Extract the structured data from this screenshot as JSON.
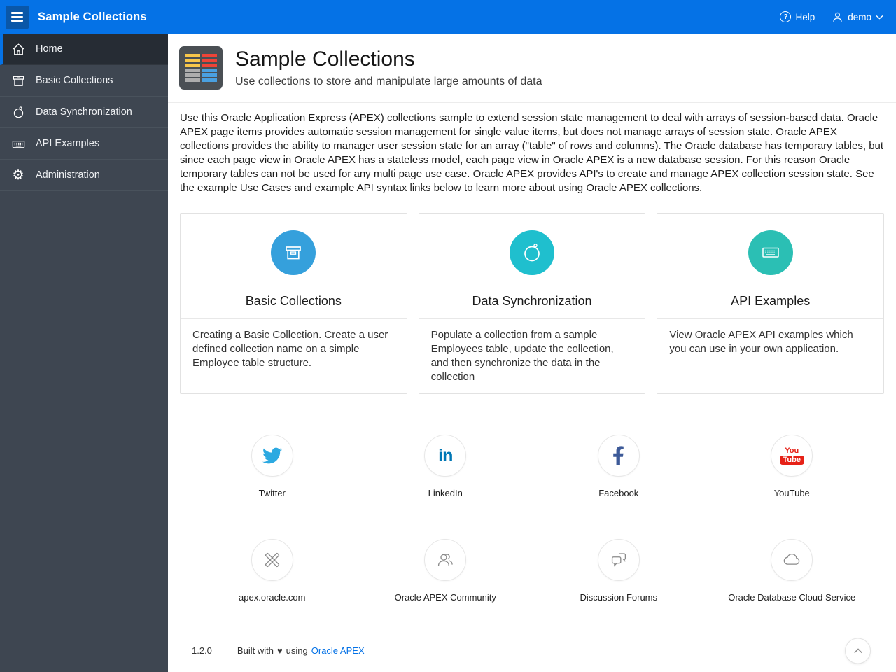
{
  "topbar": {
    "title": "Sample Collections",
    "help_label": "Help",
    "help_glyph": "?",
    "user_name": "demo"
  },
  "sidebar": {
    "items": [
      {
        "label": "Home",
        "icon": "home-icon",
        "active": true
      },
      {
        "label": "Basic Collections",
        "icon": "archive-box-icon",
        "active": false
      },
      {
        "label": "Data Synchronization",
        "icon": "timer-icon",
        "active": false
      },
      {
        "label": "API Examples",
        "icon": "keyboard-icon",
        "active": false
      },
      {
        "label": "Administration",
        "icon": "gear-icon",
        "active": false
      }
    ],
    "gear_glyph": "⚙"
  },
  "header": {
    "title": "Sample Collections",
    "subtitle": "Use collections to store and manipulate large amounts of data"
  },
  "intro": "Use this Oracle Application Express (APEX) collections sample to extend session state management to deal with arrays of session-based data. Oracle APEX page items provides automatic session management for single value items, but does not manage arrays of session state. Oracle APEX collections provides the ability to manager user session state for an array (\"table\" of rows and columns). The Oracle database has temporary tables, but since each page view in Oracle APEX has a stateless model, each page view in Oracle APEX is a new database session. For this reason Oracle temporary tables can not be used for any multi page use case. Oracle APEX provides API's to create and manage APEX collection session state. See the example Use Cases and example API syntax links below to learn more about using Oracle APEX collections.",
  "cards": [
    {
      "title": "Basic Collections",
      "icon": "box-icon",
      "circle_color": "#35A0DC",
      "description": "Creating a Basic Collection. Create a user defined collection name on a simple Employee table structure."
    },
    {
      "title": "Data Synchronization",
      "icon": "timer-icon",
      "circle_color": "#1FBFCE",
      "description": "Populate a collection from a sample Employees table, update the collection, and then synchronize the data in the collection"
    },
    {
      "title": "API Examples",
      "icon": "keyboard-icon",
      "circle_color": "#2BBFB4",
      "description": "View Oracle APEX API examples which you can use in your own application."
    }
  ],
  "links": {
    "row1": [
      {
        "label": "Twitter",
        "icon": "twitter-icon"
      },
      {
        "label": "LinkedIn",
        "icon": "linkedin-icon"
      },
      {
        "label": "Facebook",
        "icon": "facebook-icon"
      },
      {
        "label": "YouTube",
        "icon": "youtube-icon"
      }
    ],
    "row2": [
      {
        "label": "apex.oracle.com",
        "icon": "design-tools-icon"
      },
      {
        "label": "Oracle APEX Community",
        "icon": "people-icon"
      },
      {
        "label": "Discussion Forums",
        "icon": "chat-bubbles-icon"
      },
      {
        "label": "Oracle Database Cloud Service",
        "icon": "cloud-icon"
      }
    ],
    "linkedin_glyph": "in",
    "youtube_badge_top": "You",
    "youtube_badge_bottom": "Tube"
  },
  "footer": {
    "version": "1.2.0",
    "built_with": "Built with",
    "heart": "♥",
    "using": "using",
    "link_label": "Oracle APEX"
  },
  "colors": {
    "topbar_blue": "#0572E6",
    "hamburger_blue": "#0A57A8",
    "sidebar_gray": "#3E4651",
    "sidebar_active": "#262C34",
    "accent_blue": "#0572E6",
    "card_circle_blue": "#35A0DC",
    "card_circle_cyan": "#1FBFCE",
    "card_circle_teal": "#2BBFB4",
    "twitter_blue": "#2CA9E1",
    "linkedin_blue": "#0077B5",
    "facebook_blue": "#3D5A98",
    "youtube_red": "#E62117",
    "app_icon_bg": "#4A4F54",
    "app_icon_yellow": "#F7C64A",
    "app_icon_red": "#EF4438",
    "app_icon_gray": "#ADADAD",
    "app_icon_blue": "#4AA0E0"
  }
}
